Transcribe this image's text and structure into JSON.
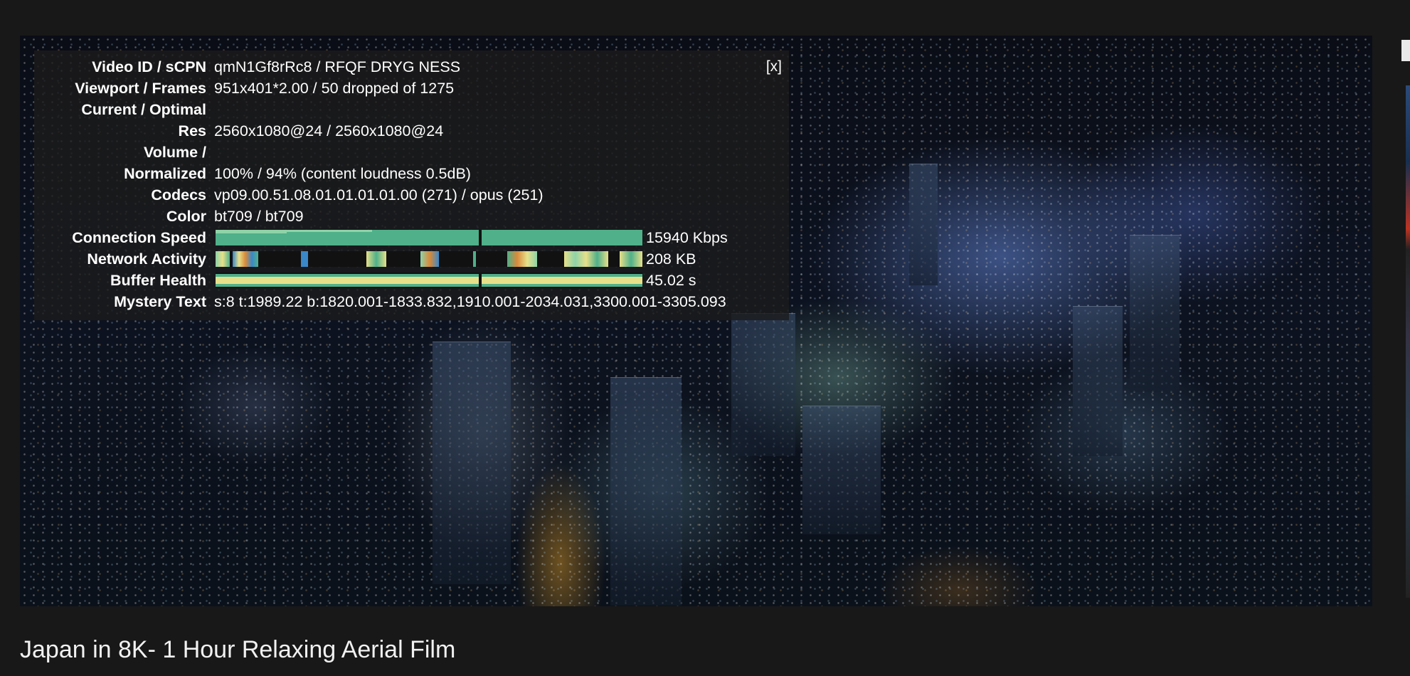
{
  "video": {
    "title": "Japan in 8K- 1 Hour Relaxing Aerial Film"
  },
  "stats_panel": {
    "close_label": "[x]",
    "rows": [
      {
        "label": "Video ID / sCPN",
        "value": "qmN1Gf8rRc8 / RFQF DRYG NESS"
      },
      {
        "label": "Viewport / Frames",
        "value": "951x401*2.00 / 50 dropped of 1275"
      },
      {
        "label": "Current / Optimal",
        "value": ""
      },
      {
        "label": "Res",
        "value": "2560x1080@24 / 2560x1080@24"
      },
      {
        "label": "Volume /",
        "value": ""
      },
      {
        "label": "Normalized",
        "value": "100% / 94% (content loudness 0.5dB)"
      },
      {
        "label": "Codecs",
        "value": "vp09.00.51.08.01.01.01.01.00 (271) / opus (251)"
      },
      {
        "label": "Color",
        "value": "bt709 / bt709"
      }
    ],
    "connection_speed": {
      "label": "Connection Speed",
      "value": "15940 Kbps"
    },
    "network_activity": {
      "label": "Network Activity",
      "value": "208 KB"
    },
    "buffer_health": {
      "label": "Buffer Health",
      "value": "45.02 s"
    },
    "mystery_text": {
      "label": "Mystery Text",
      "value": "s:8 t:1989.22 b:1820.001-1833.832,1910.001-2034.031,3300.001-3305.093"
    }
  },
  "colors": {
    "graph_green": "#4fb08a",
    "graph_light_green": "#8fd3a8",
    "graph_yellow": "#e7e08a",
    "graph_orange": "#d98a3a",
    "graph_blue": "#3a88c8",
    "overlay_bg": "#1c1c1c",
    "page_bg": "#181818"
  }
}
